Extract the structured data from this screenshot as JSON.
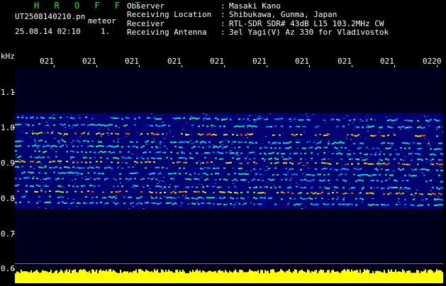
{
  "header": {
    "brand": "HROFFT",
    "filename": "UT2508140210.pn",
    "meteor": "meteor",
    "datetime": "25.08.14 02:10",
    "counter": "1.",
    "info": [
      {
        "label": "Observer",
        "sep": ":",
        "value": "Masaki Kano"
      },
      {
        "label": "Receiving Location",
        "sep": ":",
        "value": "Shibukawa, Gunma, Japan"
      },
      {
        "label": "Receiver",
        "sep": ":",
        "value": "RTL-SDR SDR# 43dB L15 103.2MHz CW"
      },
      {
        "label": "Receiving Antenna",
        "sep": ":",
        "value": "3el Yagi(V) Az 330 for Vladivostok"
      }
    ]
  },
  "axes": {
    "frequency_unit": "kHz",
    "frequency_ticks": [
      "1.1",
      "1.0",
      "0.9",
      "0.8",
      "0.7",
      "0.6"
    ],
    "time_ticks": [
      "021",
      "021",
      "021",
      "021",
      "021",
      "021",
      "021",
      "021",
      "021",
      "0220"
    ]
  },
  "colors": {
    "brand": "#00ff00",
    "background": "#000000",
    "spectrogram_noise": "#000080",
    "signal_level": "#ffff00"
  }
}
